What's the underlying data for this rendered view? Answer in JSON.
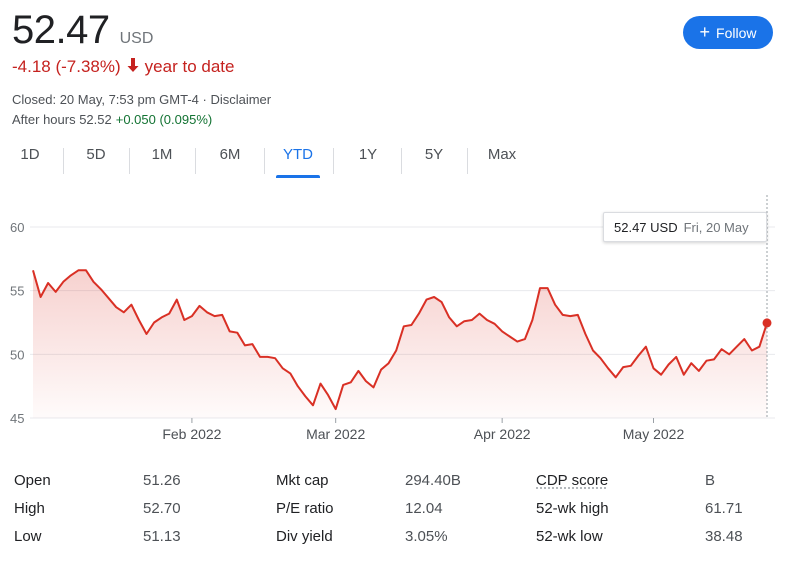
{
  "quote": {
    "price": "52.47",
    "currency": "USD",
    "change": "-4.18 (-7.38%)",
    "change_period": "year to date",
    "closed_text": "Closed: 20 May, 7:53 pm GMT-4 · Disclaimer",
    "after_hours_label": "After hours 52.52",
    "after_hours_change": "+0.050 (0.095%)"
  },
  "follow": {
    "label": "Follow"
  },
  "tabs": [
    {
      "label": "1D",
      "active": false
    },
    {
      "label": "5D",
      "active": false
    },
    {
      "label": "1M",
      "active": false
    },
    {
      "label": "6M",
      "active": false
    },
    {
      "label": "YTD",
      "active": true
    },
    {
      "label": "1Y",
      "active": false
    },
    {
      "label": "5Y",
      "active": false
    },
    {
      "label": "Max",
      "active": false
    }
  ],
  "tooltip": {
    "price": "52.47 USD",
    "date": "Fri, 20 May"
  },
  "colors": {
    "line": "#d93025",
    "accent": "#1a73e8",
    "negative": "#c5221f",
    "positive": "#137333"
  },
  "chart_data": {
    "type": "area",
    "title": "",
    "xlabel": "",
    "ylabel": "",
    "ylim": [
      45,
      60
    ],
    "yticks": [
      45,
      50,
      55,
      60
    ],
    "xticks": [
      {
        "label": "Feb 2022",
        "index": 21
      },
      {
        "label": "Mar 2022",
        "index": 40
      },
      {
        "label": "Apr 2022",
        "index": 62
      },
      {
        "label": "May 2022",
        "index": 82
      }
    ],
    "grid": true,
    "series": [
      {
        "values": [
          56.6,
          54.5,
          55.6,
          54.9,
          55.7,
          56.2,
          56.6,
          56.6,
          55.7,
          55.1,
          54.4,
          53.7,
          53.3,
          53.9,
          52.7,
          51.6,
          52.5,
          52.9,
          53.2,
          54.3,
          52.7,
          53.0,
          53.8,
          53.3,
          53.0,
          53.1,
          51.8,
          51.7,
          50.7,
          50.8,
          49.8,
          49.8,
          49.7,
          48.9,
          48.5,
          47.5,
          46.7,
          46.0,
          47.7,
          46.8,
          45.7,
          47.6,
          47.8,
          48.7,
          47.9,
          47.4,
          48.8,
          49.3,
          50.3,
          52.2,
          52.3,
          53.2,
          54.3,
          54.5,
          54.1,
          52.9,
          52.2,
          52.6,
          52.7,
          53.2,
          52.7,
          52.4,
          51.8,
          51.4,
          51.0,
          51.2,
          52.7,
          55.2,
          55.2,
          53.9,
          53.1,
          53.0,
          53.1,
          51.6,
          50.3,
          49.7,
          48.9,
          48.2,
          49.0,
          49.1,
          49.9,
          50.6,
          48.9,
          48.4,
          49.2,
          49.8,
          48.4,
          49.3,
          48.7,
          49.5,
          49.6,
          50.4,
          50.0,
          50.6,
          51.2,
          50.3,
          50.6,
          52.47
        ]
      }
    ],
    "last_value": 52.47
  },
  "stats": {
    "col1": [
      {
        "label": "Open",
        "value": "51.26"
      },
      {
        "label": "High",
        "value": "52.70"
      },
      {
        "label": "Low",
        "value": "51.13"
      }
    ],
    "col2": [
      {
        "label": "Mkt cap",
        "value": "294.40B"
      },
      {
        "label": "P/E ratio",
        "value": "12.04"
      },
      {
        "label": "Div yield",
        "value": "3.05%"
      }
    ],
    "col3": [
      {
        "label": "CDP score",
        "value": "B"
      },
      {
        "label": "52-wk high",
        "value": "61.71"
      },
      {
        "label": "52-wk low",
        "value": "38.48"
      }
    ]
  }
}
